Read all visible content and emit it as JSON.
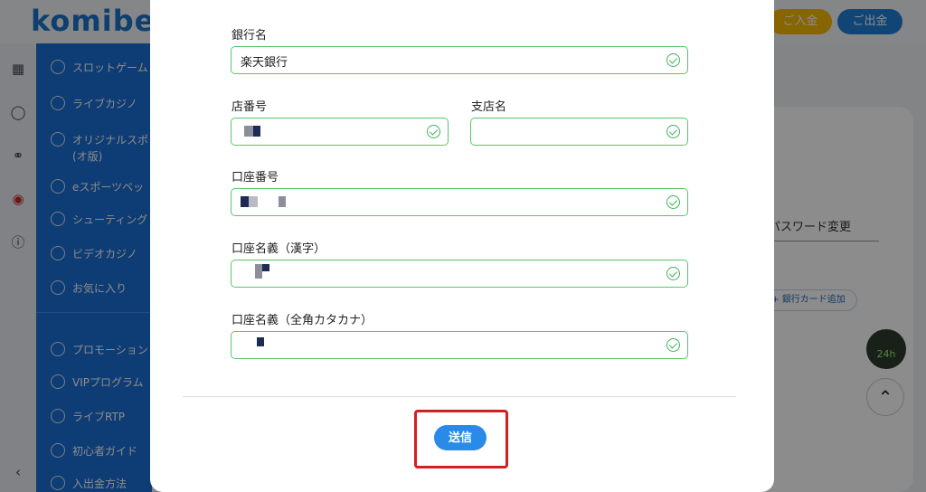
{
  "app": {
    "logo": "komibe",
    "deposit_button": "ご入金",
    "withdraw_button": "ご出金"
  },
  "sidebar": {
    "items": [
      {
        "label": "スロットゲーム",
        "icon": "slot-icon"
      },
      {
        "label": "ライブカジノ",
        "icon": "dealer-icon"
      },
      {
        "label": "オリジナルスポ",
        "icon": "soccer-icon"
      },
      {
        "label": "(オ版)",
        "icon": ""
      },
      {
        "label": "eスポーツベッ",
        "icon": "gamepad-icon"
      },
      {
        "label": "シューティング",
        "icon": "target-icon"
      },
      {
        "label": "ビデオカジノ",
        "icon": "chip-icon"
      },
      {
        "label": "お気に入り",
        "icon": "heart-icon"
      },
      {
        "label": "プロモーション",
        "icon": "gift-icon"
      },
      {
        "label": "VIPプログラム",
        "icon": "crown-icon"
      },
      {
        "label": "ライブRTP",
        "icon": "pulse-icon"
      },
      {
        "label": "初心者ガイド",
        "icon": "book-icon"
      },
      {
        "label": "入出金方法",
        "icon": "wallet-icon"
      }
    ]
  },
  "background": {
    "password_tab": "パスワード変更",
    "add_card_button": "+ 銀行カード追加",
    "support_badge": "24h",
    "to_top": "⌃"
  },
  "form": {
    "bank_name": {
      "label": "銀行名",
      "value": "楽天銀行"
    },
    "branch_no": {
      "label": "店番号",
      "value": ""
    },
    "branch_name": {
      "label": "支店名",
      "value": ""
    },
    "account_no": {
      "label": "口座番号",
      "value": ""
    },
    "holder_kanji": {
      "label": "口座名義（漢字）",
      "value": ""
    },
    "holder_kana": {
      "label": "口座名義（全角カタカナ）",
      "value": ""
    },
    "submit_label": "送信"
  },
  "colors": {
    "valid_border": "#5cc46c",
    "submit_bg": "#2a8ae8",
    "highlight": "#d21f1f",
    "sidebar_bg": "#1b6ed3"
  }
}
